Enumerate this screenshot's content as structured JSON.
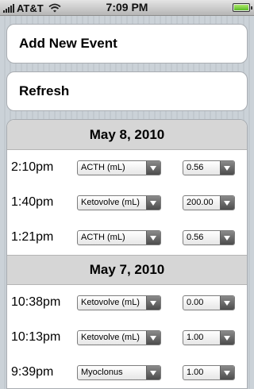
{
  "status_bar": {
    "carrier": "AT&T",
    "time": "7:09 PM"
  },
  "actions": {
    "add_label": "Add New Event",
    "refresh_label": "Refresh"
  },
  "sections": [
    {
      "date": "May 8, 2010",
      "rows": [
        {
          "time": "2:10pm",
          "type": "ACTH (mL)",
          "value": "0.56"
        },
        {
          "time": "1:40pm",
          "type": "Ketovolve (mL)",
          "value": "200.00"
        },
        {
          "time": "1:21pm",
          "type": "ACTH (mL)",
          "value": "0.56"
        }
      ]
    },
    {
      "date": "May 7, 2010",
      "rows": [
        {
          "time": "10:38pm",
          "type": "Ketovolve (mL)",
          "value": "0.00"
        },
        {
          "time": "10:13pm",
          "type": "Ketovolve (mL)",
          "value": "1.00"
        },
        {
          "time": "9:39pm",
          "type": "Myoclonus",
          "value": "1.00"
        }
      ]
    }
  ]
}
